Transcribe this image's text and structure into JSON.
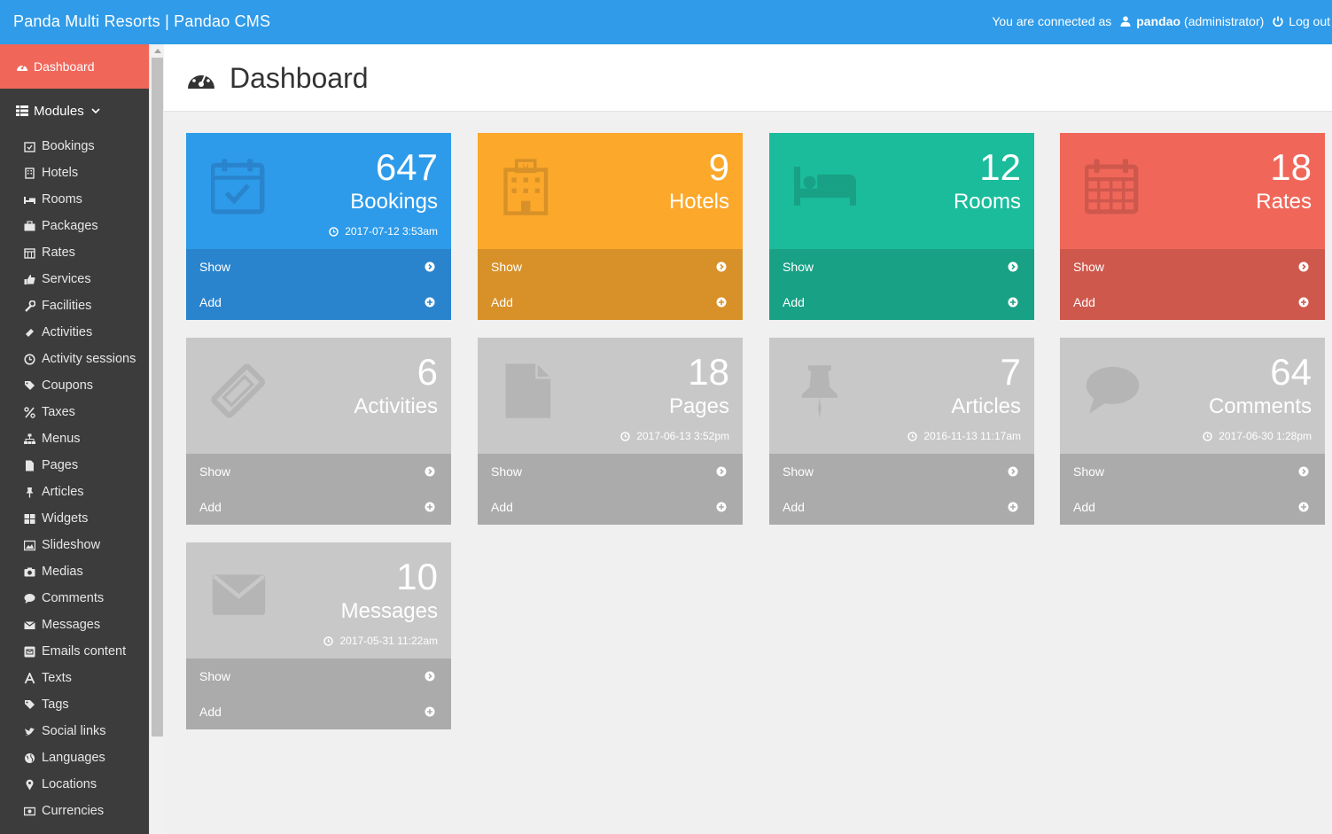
{
  "header": {
    "brand": "Panda Multi Resorts | Pandao CMS",
    "connected_text": "You are connected as",
    "username": "pandao",
    "role": "(administrator)",
    "logout": "Log out"
  },
  "sidebar": {
    "dashboard": "Dashboard",
    "modules": "Modules",
    "items": [
      {
        "label": "Bookings",
        "icon": "calendar-check-icon"
      },
      {
        "label": "Hotels",
        "icon": "building-icon"
      },
      {
        "label": "Rooms",
        "icon": "bed-icon"
      },
      {
        "label": "Packages",
        "icon": "briefcase-icon"
      },
      {
        "label": "Rates",
        "icon": "calendar-icon"
      },
      {
        "label": "Services",
        "icon": "thumbs-up-icon"
      },
      {
        "label": "Facilities",
        "icon": "wrench-icon"
      },
      {
        "label": "Activities",
        "icon": "ticket-icon"
      },
      {
        "label": "Activity sessions",
        "icon": "clock-icon"
      },
      {
        "label": "Coupons",
        "icon": "tags-icon"
      },
      {
        "label": "Taxes",
        "icon": "percent-icon"
      },
      {
        "label": "Menus",
        "icon": "sitemap-icon"
      },
      {
        "label": "Pages",
        "icon": "file-icon"
      },
      {
        "label": "Articles",
        "icon": "thumbtack-icon"
      },
      {
        "label": "Widgets",
        "icon": "grid-icon"
      },
      {
        "label": "Slideshow",
        "icon": "image-icon"
      },
      {
        "label": "Medias",
        "icon": "camera-icon"
      },
      {
        "label": "Comments",
        "icon": "comment-icon"
      },
      {
        "label": "Messages",
        "icon": "envelope-icon"
      },
      {
        "label": "Emails content",
        "icon": "envelope-square-icon"
      },
      {
        "label": "Texts",
        "icon": "font-icon"
      },
      {
        "label": "Tags",
        "icon": "tag-icon"
      },
      {
        "label": "Social links",
        "icon": "twitter-icon"
      },
      {
        "label": "Languages",
        "icon": "globe-icon"
      },
      {
        "label": "Locations",
        "icon": "map-marker-icon"
      },
      {
        "label": "Currencies",
        "icon": "money-icon"
      }
    ]
  },
  "page": {
    "title": "Dashboard"
  },
  "cards": [
    {
      "count": "647",
      "label": "Bookings",
      "date": "2017-07-12 3:53am",
      "show": "Show",
      "add": "Add"
    },
    {
      "count": "9",
      "label": "Hotels",
      "date": "",
      "show": "Show",
      "add": "Add"
    },
    {
      "count": "12",
      "label": "Rooms",
      "date": "",
      "show": "Show",
      "add": "Add"
    },
    {
      "count": "18",
      "label": "Rates",
      "date": "",
      "show": "Show",
      "add": "Add"
    },
    {
      "count": "6",
      "label": "Activities",
      "date": "",
      "show": "Show",
      "add": "Add"
    },
    {
      "count": "18",
      "label": "Pages",
      "date": "2017-06-13 3:52pm",
      "show": "Show",
      "add": "Add"
    },
    {
      "count": "7",
      "label": "Articles",
      "date": "2016-11-13 11:17am",
      "show": "Show",
      "add": "Add"
    },
    {
      "count": "64",
      "label": "Comments",
      "date": "2017-06-30 1:28pm",
      "show": "Show",
      "add": "Add"
    },
    {
      "count": "10",
      "label": "Messages",
      "date": "2017-05-31 11:22am",
      "show": "Show",
      "add": "Add"
    }
  ],
  "colors": {
    "topbar": "#2f9be9",
    "sidebar": "#3c3c3c",
    "active": "#f0675a",
    "blue": "#2d9be9",
    "orange": "#fba82b",
    "green": "#1bbc9b",
    "red": "#f0675a",
    "grey": "#c8c8c8"
  }
}
